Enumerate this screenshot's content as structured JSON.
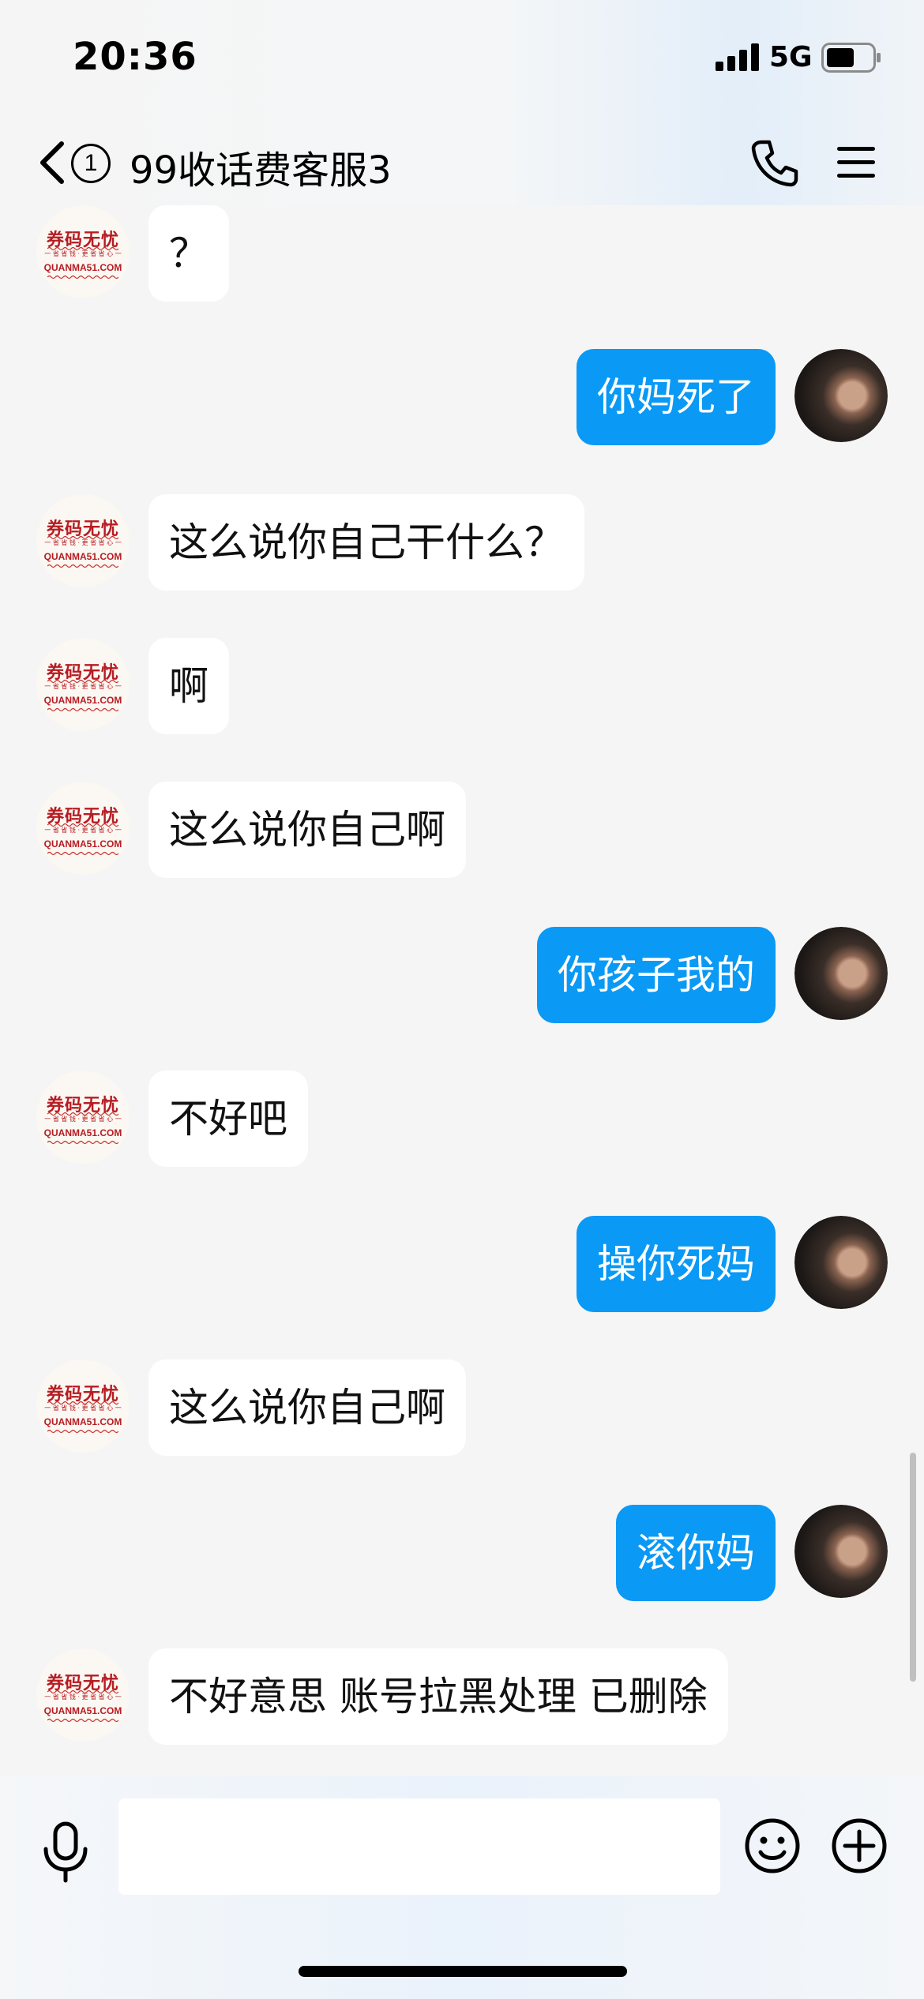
{
  "status_bar": {
    "time": "20:36",
    "network": "5G"
  },
  "header": {
    "unread_count": "1",
    "title": "99收话费客服3"
  },
  "contact_avatar": {
    "brand": "券码无忧",
    "tagline": "一 省 省 钱 · 更 省 省 心 一",
    "domain": "QUANMA51.COM"
  },
  "messages": [
    {
      "side": "in",
      "text": "？"
    },
    {
      "side": "out",
      "text": "你妈死了"
    },
    {
      "side": "in",
      "text": "这么说你自己干什么？"
    },
    {
      "side": "in",
      "text": "啊"
    },
    {
      "side": "in",
      "text": "这么说你自己啊"
    },
    {
      "side": "out",
      "text": "你孩子我的"
    },
    {
      "side": "in",
      "text": "不好吧"
    },
    {
      "side": "out",
      "text": "操你死妈"
    },
    {
      "side": "in",
      "text": "这么说你自己啊"
    },
    {
      "side": "out",
      "text": "滚你妈"
    },
    {
      "side": "in",
      "text": "不好意思 账号拉黑处理 已删除"
    }
  ],
  "input": {
    "value": "",
    "placeholder": ""
  },
  "icons": {
    "back": "chevron-left-icon",
    "phone": "phone-icon",
    "menu": "menu-icon",
    "voice": "microphone-icon",
    "emoji": "emoji-icon",
    "more": "plus-icon"
  },
  "colors": {
    "outgoing_bubble": "#0a99f5",
    "incoming_bubble": "#ffffff",
    "background": "#f5f5f5"
  }
}
